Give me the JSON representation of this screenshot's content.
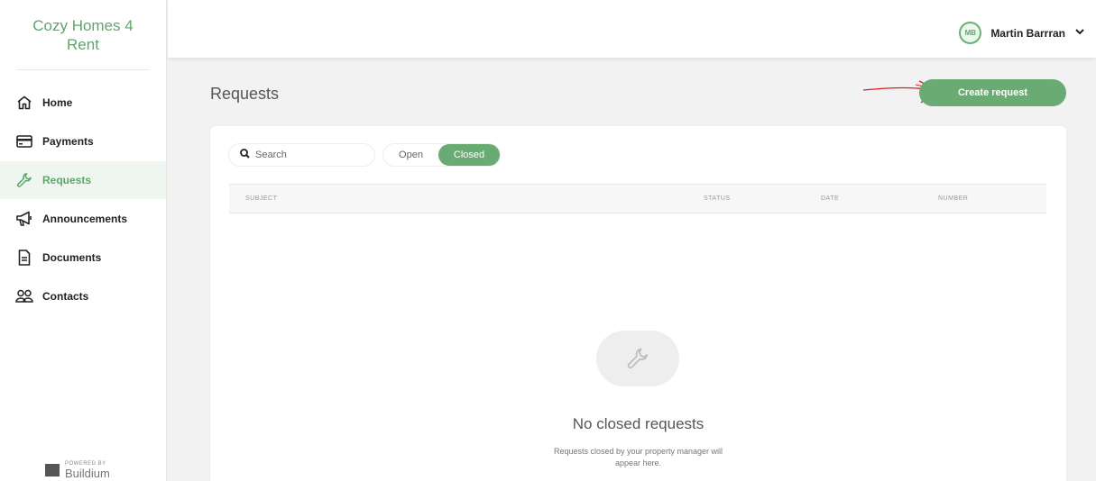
{
  "brand": {
    "line1": "Cozy Homes 4",
    "line2": "Rent"
  },
  "nav": [
    {
      "label": "Home",
      "icon": "home-icon"
    },
    {
      "label": "Payments",
      "icon": "credit-card-icon"
    },
    {
      "label": "Requests",
      "icon": "wrench-icon",
      "active": true
    },
    {
      "label": "Announcements",
      "icon": "megaphone-icon"
    },
    {
      "label": "Documents",
      "icon": "document-icon"
    },
    {
      "label": "Contacts",
      "icon": "contacts-icon"
    }
  ],
  "powered": {
    "line1": "POWERED BY",
    "line2": "Buildium"
  },
  "user": {
    "initials": "MB",
    "name": "Martin Barrran"
  },
  "page": {
    "title": "Requests",
    "create_label": "Create request"
  },
  "search": {
    "placeholder": "Search"
  },
  "filter": {
    "options": [
      "Open",
      "Closed"
    ],
    "selected": "Closed"
  },
  "table": {
    "columns": [
      "SUBJECT",
      "STATUS",
      "DATE",
      "NUMBER"
    ]
  },
  "empty": {
    "title": "No closed requests",
    "desc_line1": "Requests closed by your property manager will",
    "desc_line2": "appear here."
  },
  "colors": {
    "accent": "#6aab74",
    "annotation": "#e02020"
  }
}
